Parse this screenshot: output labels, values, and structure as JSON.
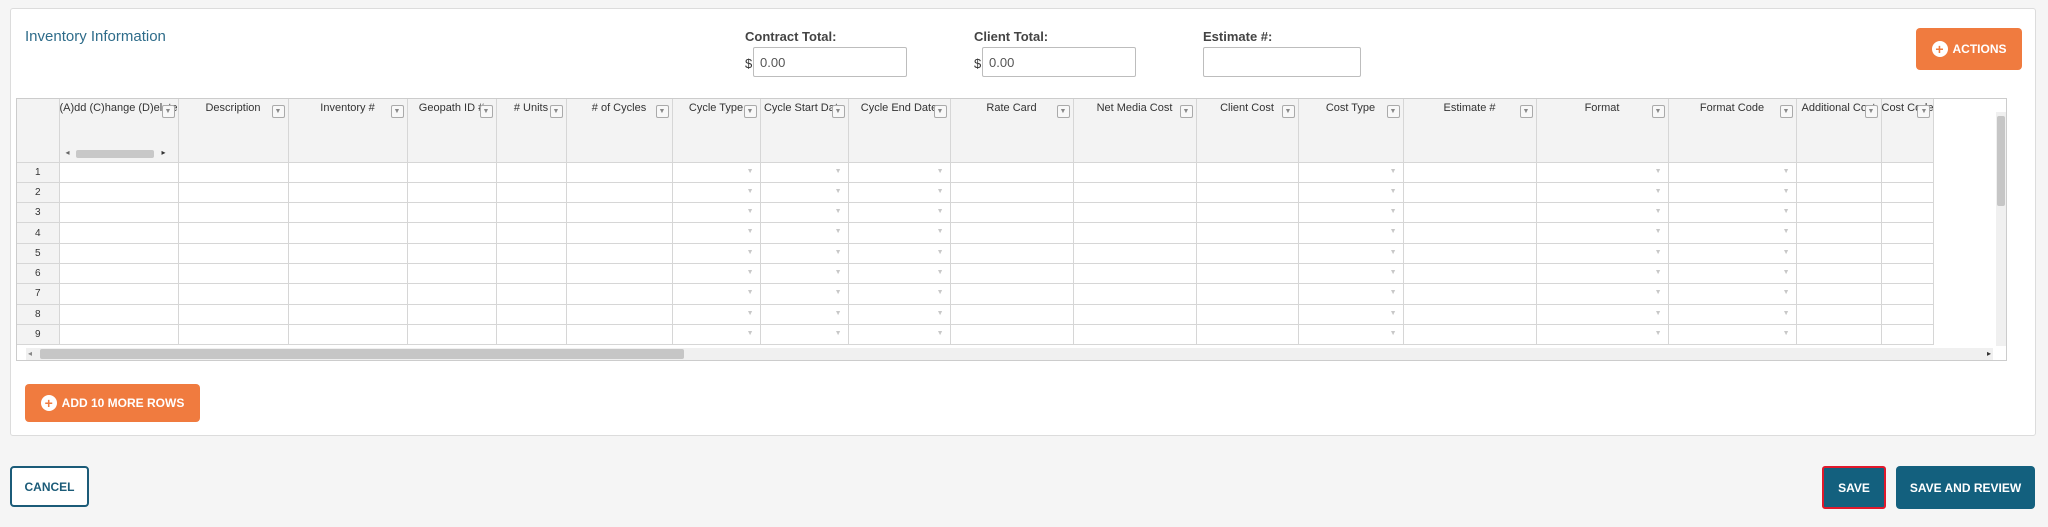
{
  "section_title": "Inventory Information",
  "totals": {
    "contract_label": "Contract Total:",
    "contract_currency": "$",
    "contract_value": "0.00",
    "client_label": "Client Total:",
    "client_currency": "$",
    "client_value": "0.00",
    "estimate_label": "Estimate #:",
    "estimate_value": ""
  },
  "actions_label": "ACTIONS",
  "grid": {
    "columns": [
      "(A)dd (C)hange (D)elete",
      "Description",
      "Inventory #",
      "Geopath ID #",
      "# Units",
      "# of Cycles",
      "Cycle Type",
      "Cycle Start Date",
      "Cycle End Date",
      "Rate Card",
      "Net Media Cost",
      "Client Cost",
      "Cost Type",
      "Estimate #",
      "Format",
      "Format Code",
      "Additional Cost",
      "Cost Code"
    ],
    "row_numbers": [
      "1",
      "2",
      "3",
      "4",
      "5",
      "6",
      "7",
      "8",
      "9"
    ],
    "dropdown_columns": [
      6,
      7,
      8,
      12,
      14,
      15
    ]
  },
  "add_rows_label": "ADD 10 MORE ROWS",
  "footer": {
    "cancel_label": "CANCEL",
    "save_label": "SAVE",
    "save_review_label": "SAVE AND REVIEW"
  },
  "colors": {
    "accent_orange": "#f07b3f",
    "primary_teal": "#13607e",
    "title_blue": "#2e6c8a",
    "highlight_red": "#e0192c"
  }
}
